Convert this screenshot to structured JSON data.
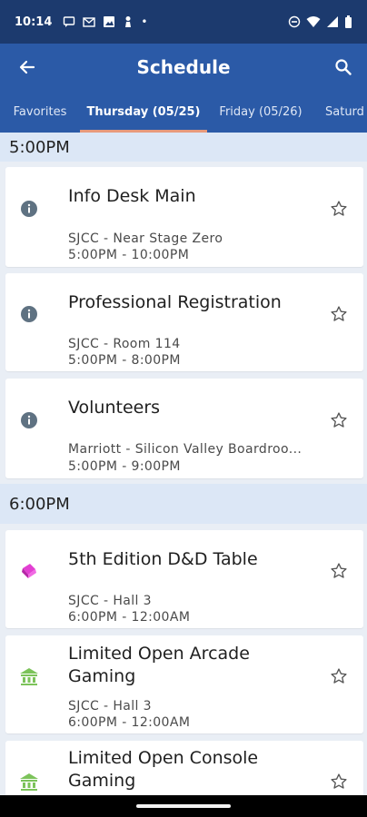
{
  "status": {
    "time": "10:14"
  },
  "header": {
    "title": "Schedule"
  },
  "tabs": [
    {
      "label": "Favorites"
    },
    {
      "label": "Thursday (05/25)"
    },
    {
      "label": "Friday (05/26)"
    },
    {
      "label": "Saturd"
    }
  ],
  "sections": [
    {
      "label": "5:00PM",
      "events": [
        {
          "icon": "info-icon",
          "name": "Info Desk Main",
          "location": "SJCC - Near Stage Zero",
          "time": "5:00PM - 10:00PM"
        },
        {
          "icon": "info-icon",
          "name": "Professional Registration",
          "location": "SJCC - Room 114",
          "time": "5:00PM - 8:00PM"
        },
        {
          "icon": "info-icon",
          "name": "Volunteers",
          "location": "Marriott - Silicon Valley Boardroo...",
          "time": "5:00PM - 9:00PM"
        }
      ]
    },
    {
      "label": "6:00PM",
      "events": [
        {
          "icon": "dice-icon",
          "name": "5th Edition D&D Table",
          "location": "SJCC - Hall 3",
          "time": "6:00PM - 12:00AM"
        },
        {
          "icon": "arcade-icon",
          "name": "Limited Open Arcade Gaming",
          "location": "SJCC - Hall 3",
          "time": "6:00PM - 12:00AM"
        },
        {
          "icon": "arcade-icon",
          "name": "Limited Open Console Gaming",
          "location": "",
          "time": ""
        }
      ]
    }
  ],
  "colors": {
    "status_bar": "#1c3a6e",
    "app_bar": "#2b5aa7",
    "tab_indicator": "#e79a7c",
    "section_bg": "#dce7f6",
    "info_icon": "#5f7282",
    "dice_icon": "#e23fd2",
    "arcade_icon": "#7cc35a"
  }
}
